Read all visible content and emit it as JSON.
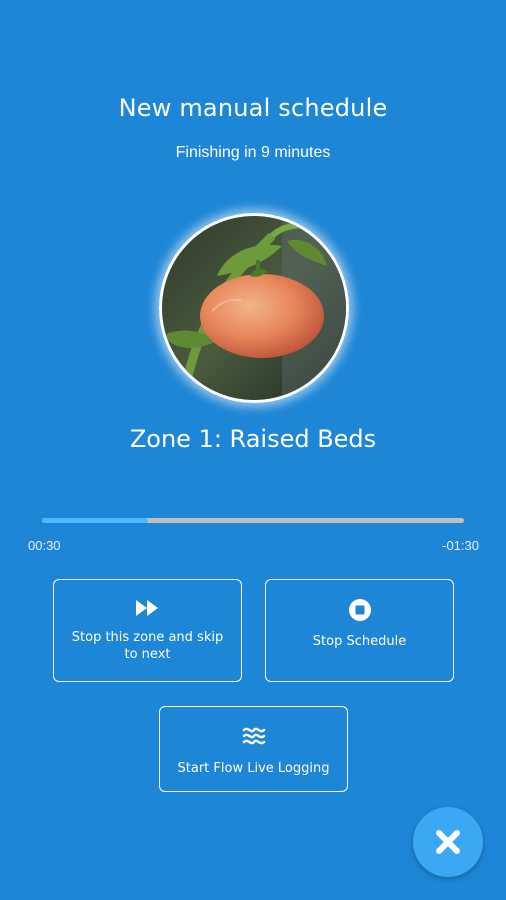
{
  "header": {
    "title": "New manual schedule",
    "subtitle": "Finishing in 9 minutes"
  },
  "zone": {
    "name": "Zone 1: Raised Beds",
    "photo_icon": "tomato-photo"
  },
  "progress": {
    "elapsed": "00:30",
    "remaining": "-01:30",
    "fraction": 0.25
  },
  "actions": {
    "skip": {
      "label": "Stop this zone and skip to next",
      "icon": "fast-forward-icon"
    },
    "stop": {
      "label": "Stop Schedule",
      "icon": "stop-circle-icon"
    },
    "flow": {
      "label": "Start Flow Live Logging",
      "icon": "waves-icon"
    }
  },
  "fab": {
    "icon": "close-icon"
  },
  "colors": {
    "background": "#1e86d6",
    "progress_fill": "#4fb8ff",
    "progress_track": "#bfbfbf",
    "fab": "#3aa8f2"
  }
}
